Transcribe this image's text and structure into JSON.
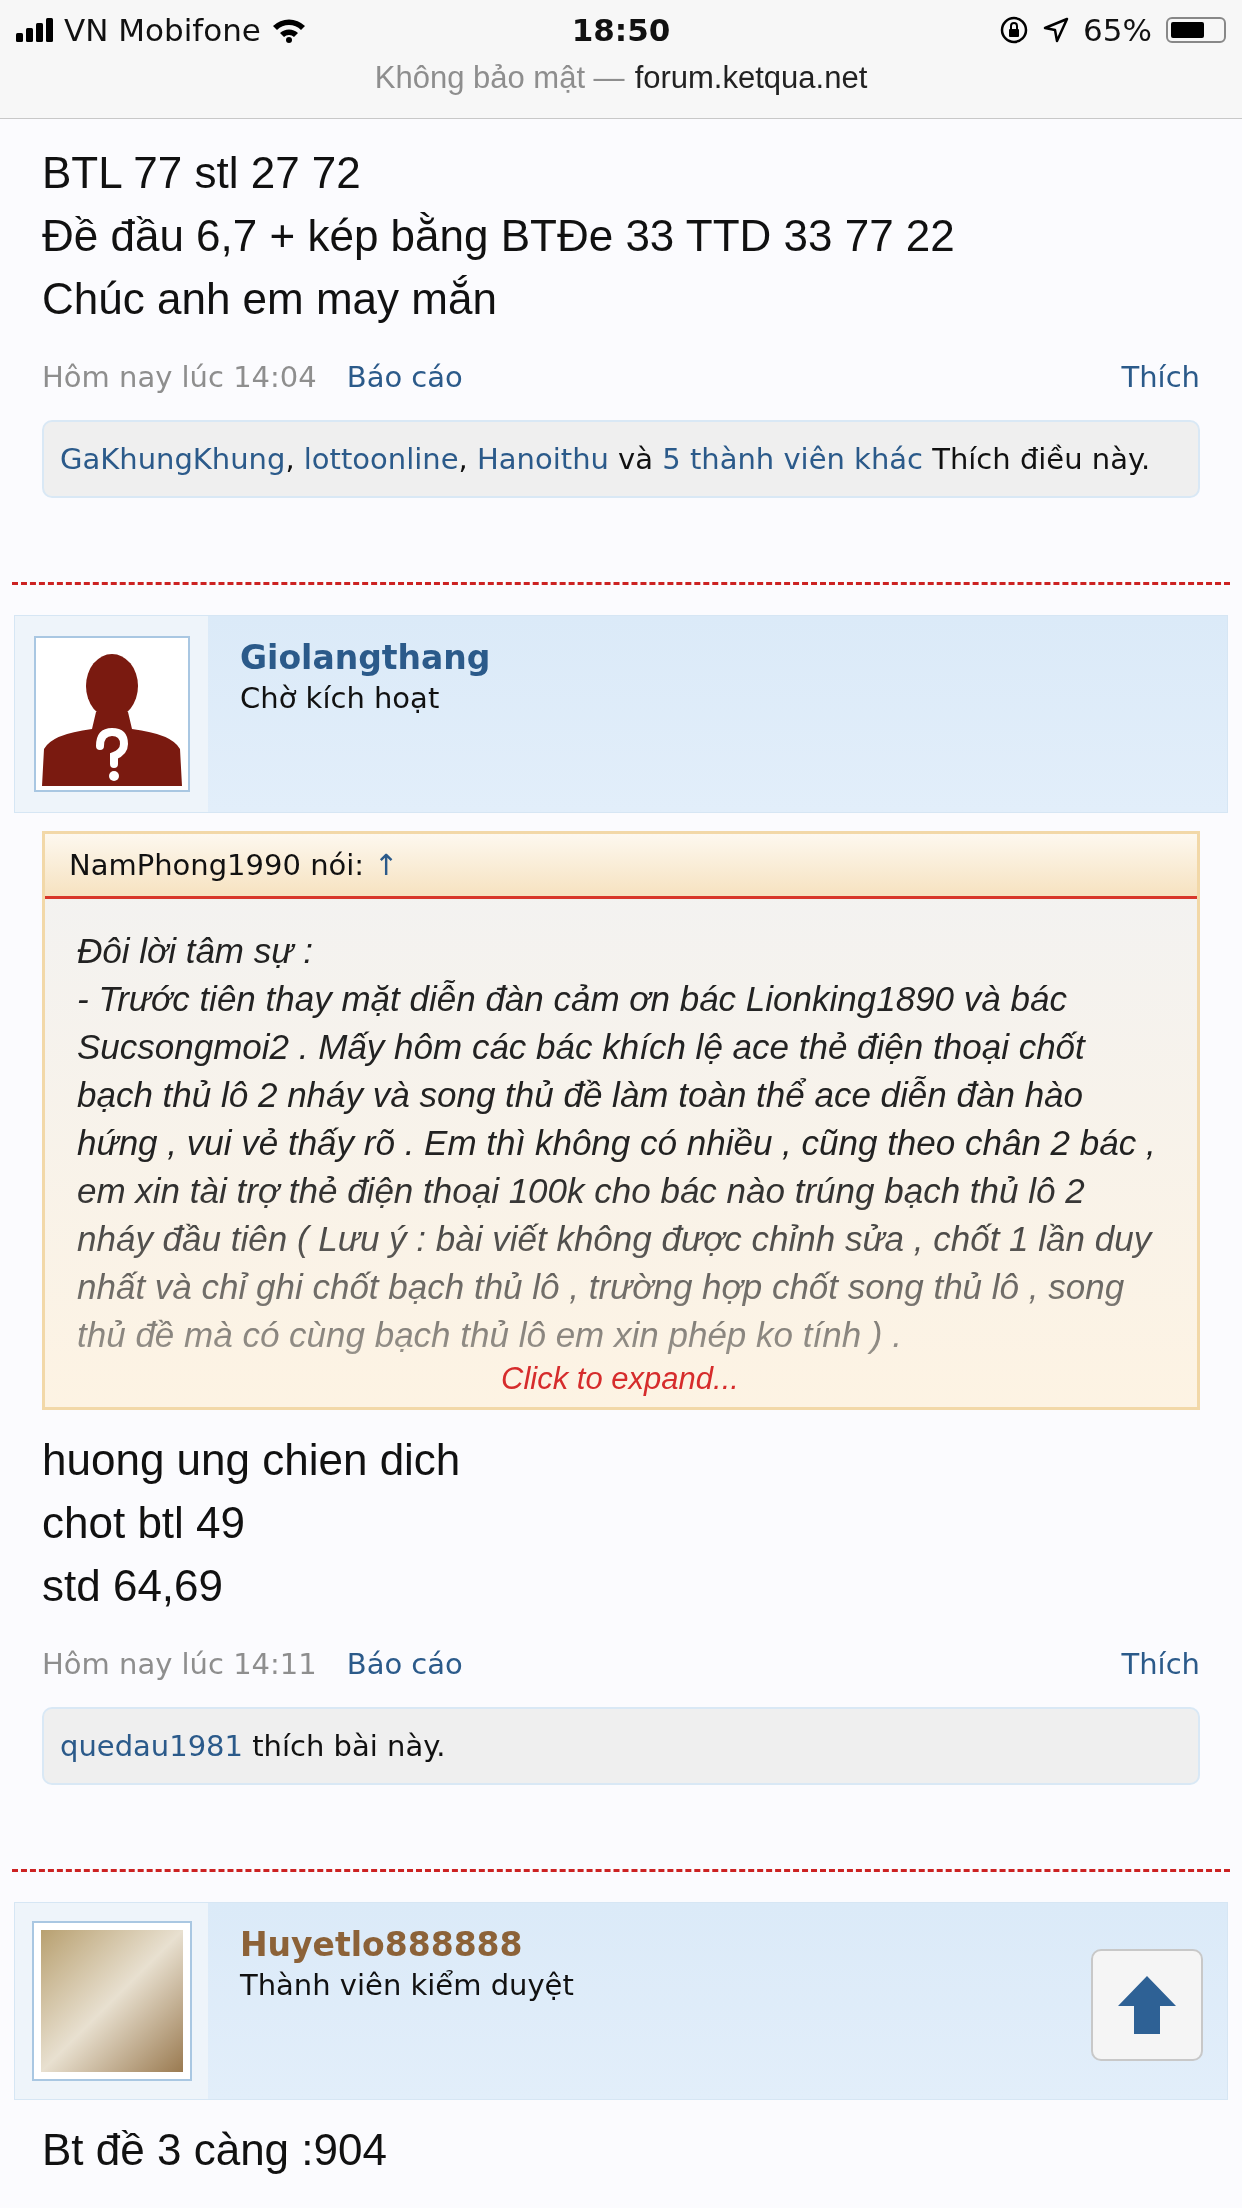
{
  "status_bar": {
    "carrier": "VN Mobifone",
    "time": "18:50",
    "battery_text": "65%"
  },
  "address_bar": {
    "security": "Không bảo mật —",
    "domain": "forum.ketqua.net"
  },
  "posts": [
    {
      "lines": [
        "BTL 77 stl 27 72",
        "Đề đầu 6,7 + kép bằng BTĐe 33 TTD 33 77 22",
        "Chúc anh em may mắn"
      ],
      "time": "Hôm nay lúc 14:04",
      "report": "Báo cáo",
      "like": "Thích",
      "likes": [
        {
          "kind": "user",
          "text": "GaKhungKhung"
        },
        {
          "kind": "text",
          "text": ", "
        },
        {
          "kind": "user",
          "text": "lottoonline"
        },
        {
          "kind": "text",
          "text": ", "
        },
        {
          "kind": "user",
          "text": "Hanoithu"
        },
        {
          "kind": "text",
          "text": " và "
        },
        {
          "kind": "user",
          "text": "5 thành viên khác"
        },
        {
          "kind": "text",
          "text": " Thích điều này."
        }
      ]
    },
    {
      "author": {
        "name": "Giolangthang",
        "title": "Chờ kích hoạt",
        "color": "#2b5a8a",
        "avatar": {
          "kind": "silhouette"
        }
      },
      "quote": {
        "author": "NamPhong1990 nói:",
        "jump": "↑",
        "heading": "Đôi lời tâm sự :",
        "body": "- Trước tiên thay mặt diễn đàn cảm ơn bác Lionking1890 và bác Sucsongmoi2 . Mấy hôm các bác khích lệ ace thẻ điện thoại chốt bạch thủ lô 2 nháy và song thủ đề làm toàn thể ace diễn đàn hào hứng , vui vẻ thấy rõ . Em thì không có nhiều , cũng theo chân 2 bác , em xin tài trợ thẻ điện thoại 100k cho bác nào trúng bạch thủ lô 2 nháy đầu tiên ( Lưu ý : bài viết không được chỉnh sửa , chốt 1 lần duy nhất và chỉ ghi chốt bạch thủ lô , trường hợp chốt song thủ lô , song thủ đề mà có cùng bạch thủ lô em xin phép ko tính ) .",
        "expand": "Click to expand..."
      },
      "lines": [
        "huong ung chien dich",
        "chot btl 49",
        "std 64,69"
      ],
      "time": "Hôm nay lúc 14:11",
      "report": "Báo cáo",
      "like": "Thích",
      "likes": [
        {
          "kind": "user",
          "text": "quedau1981"
        },
        {
          "kind": "text",
          "text": " thích bài này."
        }
      ]
    },
    {
      "author": {
        "name": "Huyetlo888888",
        "title": "Thành viên kiểm duyệt",
        "color": "#8c6238",
        "avatar": {
          "kind": "photo"
        }
      },
      "scroll_top": true,
      "lines": [
        "Bt đề 3 càng :904"
      ]
    }
  ]
}
